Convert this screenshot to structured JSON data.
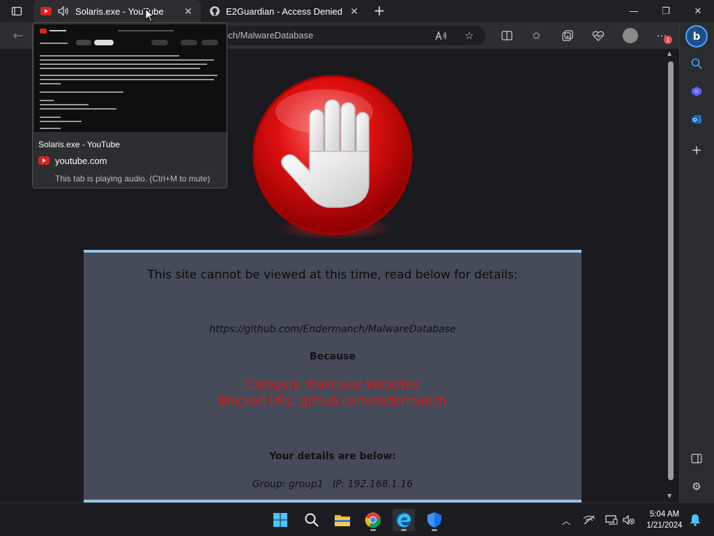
{
  "tabs": [
    {
      "title": "Solaris.exe - YouTube",
      "active": true,
      "audio": true
    },
    {
      "title": "E2Guardian - Access Denied",
      "active": false
    }
  ],
  "address": {
    "text": "nch/MalwareDatabase"
  },
  "preview": {
    "title": "Solaris.exe - YouTube",
    "domain": "youtube.com",
    "note": "This tab is playing audio. (Ctrl+M to mute)"
  },
  "block_page": {
    "heading": "This site cannot be viewed at this time, read below for details:",
    "url": "https://github.com/Endermanch/MalwareDatabase",
    "because": "Because",
    "category": "Category: Malicious Websites",
    "blocked_url": "Blocked URL: github.com/endermanch",
    "details_heading": "Your details are below:",
    "group_ip": "Group: group1   IP: 192.168.1.16"
  },
  "notification_badge": "1",
  "clock": {
    "time": "5:04 AM",
    "date": "1/21/2024"
  },
  "colors": {
    "panel_bg": "#454b58",
    "panel_border": "#9cc4e8",
    "alert_red": "#e01818",
    "page_bg": "#1b1b1f",
    "chrome_bg": "#2d2e31"
  },
  "icons": {
    "tab_actions": "tab-actions-icon",
    "youtube": "youtube-icon",
    "speaker": "speaker-icon",
    "github": "github-icon",
    "stop_hand": "stop-hand-icon",
    "edge": "edge-icon",
    "chrome": "chrome-icon"
  }
}
